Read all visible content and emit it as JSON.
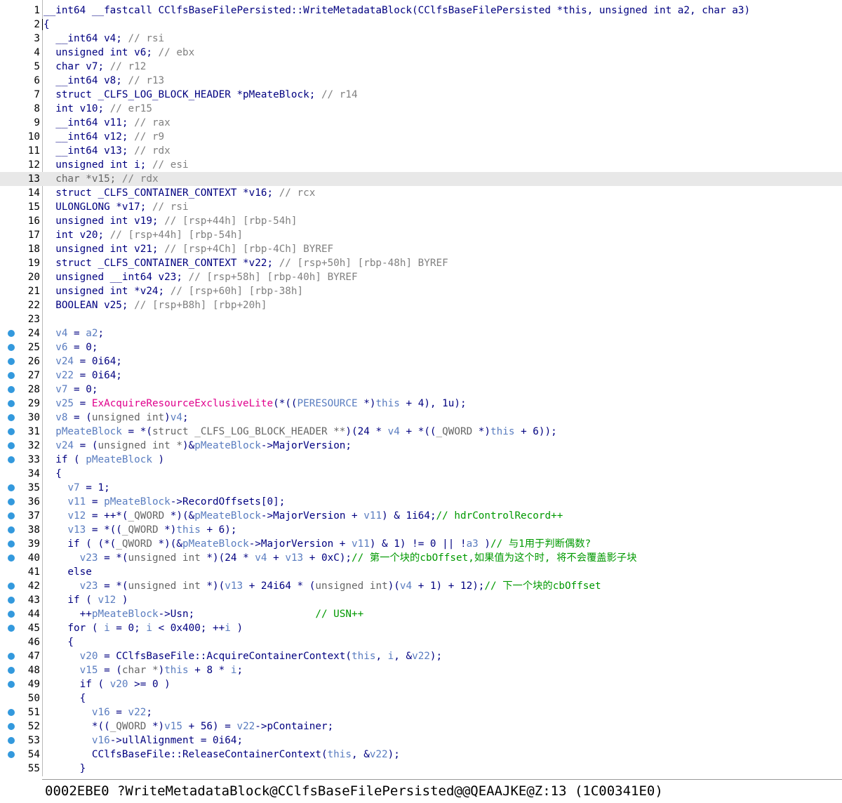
{
  "editor": {
    "highlighted_line": 13,
    "caret_line": 2,
    "lines": [
      {
        "n": "1",
        "bp": false,
        "t": [
          [
            "tp",
            "__int64 __fastcall CClfsBaseFilePersisted::WriteMetadataBlock(CClfsBaseFilePersisted *this, unsigned int a2, char a3)"
          ]
        ]
      },
      {
        "n": "2",
        "bp": false,
        "t": [
          [
            "pl",
            "{"
          ]
        ]
      },
      {
        "n": "3",
        "bp": false,
        "t": [
          [
            "tp",
            "  __int64 v4; "
          ],
          [
            "cmg",
            "// rsi"
          ]
        ]
      },
      {
        "n": "4",
        "bp": false,
        "t": [
          [
            "tp",
            "  unsigned int v6; "
          ],
          [
            "cmg",
            "// ebx"
          ]
        ]
      },
      {
        "n": "5",
        "bp": false,
        "t": [
          [
            "tp",
            "  char v7; "
          ],
          [
            "cmg",
            "// r12"
          ]
        ]
      },
      {
        "n": "6",
        "bp": false,
        "t": [
          [
            "tp",
            "  __int64 v8; "
          ],
          [
            "cmg",
            "// r13"
          ]
        ]
      },
      {
        "n": "7",
        "bp": false,
        "t": [
          [
            "tp",
            "  struct _CLFS_LOG_BLOCK_HEADER *pMeateBlock; "
          ],
          [
            "cmg",
            "// r14"
          ]
        ]
      },
      {
        "n": "8",
        "bp": false,
        "t": [
          [
            "tp",
            "  int v10; "
          ],
          [
            "cmg",
            "// er15"
          ]
        ]
      },
      {
        "n": "9",
        "bp": false,
        "t": [
          [
            "tp",
            "  __int64 v11; "
          ],
          [
            "cmg",
            "// rax"
          ]
        ]
      },
      {
        "n": "10",
        "bp": false,
        "t": [
          [
            "tp",
            "  __int64 v12; "
          ],
          [
            "cmg",
            "// r9"
          ]
        ]
      },
      {
        "n": "11",
        "bp": false,
        "t": [
          [
            "tp",
            "  __int64 v13; "
          ],
          [
            "cmg",
            "// rdx"
          ]
        ]
      },
      {
        "n": "12",
        "bp": false,
        "t": [
          [
            "tp",
            "  unsigned int i; "
          ],
          [
            "cmg",
            "// esi"
          ]
        ]
      },
      {
        "n": "13",
        "bp": false,
        "t": [
          [
            "dim",
            "  char *v15; "
          ],
          [
            "cmg",
            "// rdx"
          ]
        ]
      },
      {
        "n": "14",
        "bp": false,
        "t": [
          [
            "tp",
            "  struct _CLFS_CONTAINER_CONTEXT *v16; "
          ],
          [
            "cmg",
            "// rcx"
          ]
        ]
      },
      {
        "n": "15",
        "bp": false,
        "t": [
          [
            "tp",
            "  ULONGLONG *v17; "
          ],
          [
            "cmg",
            "// rsi"
          ]
        ]
      },
      {
        "n": "16",
        "bp": false,
        "t": [
          [
            "tp",
            "  unsigned int v19; "
          ],
          [
            "cmg",
            "// [rsp+44h] [rbp-54h]"
          ]
        ]
      },
      {
        "n": "17",
        "bp": false,
        "t": [
          [
            "tp",
            "  int v20; "
          ],
          [
            "cmg",
            "// [rsp+44h] [rbp-54h]"
          ]
        ]
      },
      {
        "n": "18",
        "bp": false,
        "t": [
          [
            "tp",
            "  unsigned int v21; "
          ],
          [
            "cmg",
            "// [rsp+4Ch] [rbp-4Ch] BYREF"
          ]
        ]
      },
      {
        "n": "19",
        "bp": false,
        "t": [
          [
            "tp",
            "  struct _CLFS_CONTAINER_CONTEXT *v22; "
          ],
          [
            "cmg",
            "// [rsp+50h] [rbp-48h] BYREF"
          ]
        ]
      },
      {
        "n": "20",
        "bp": false,
        "t": [
          [
            "tp",
            "  unsigned __int64 v23; "
          ],
          [
            "cmg",
            "// [rsp+58h] [rbp-40h] BYREF"
          ]
        ]
      },
      {
        "n": "21",
        "bp": false,
        "t": [
          [
            "tp",
            "  unsigned int *v24; "
          ],
          [
            "cmg",
            "// [rsp+60h] [rbp-38h]"
          ]
        ]
      },
      {
        "n": "22",
        "bp": false,
        "t": [
          [
            "tp",
            "  BOOLEAN v25; "
          ],
          [
            "cmg",
            "// [rsp+B8h] [rbp+20h]"
          ]
        ]
      },
      {
        "n": "23",
        "bp": false,
        "t": [
          [
            "pl",
            ""
          ]
        ]
      },
      {
        "n": "24",
        "bp": true,
        "t": [
          [
            "pl",
            "  "
          ],
          [
            "vr",
            "v4"
          ],
          [
            "pl",
            " = "
          ],
          [
            "vr",
            "a2"
          ],
          [
            "pl",
            ";"
          ]
        ]
      },
      {
        "n": "25",
        "bp": true,
        "t": [
          [
            "pl",
            "  "
          ],
          [
            "vr",
            "v6"
          ],
          [
            "pl",
            " = 0;"
          ]
        ]
      },
      {
        "n": "26",
        "bp": true,
        "t": [
          [
            "pl",
            "  "
          ],
          [
            "vr",
            "v24"
          ],
          [
            "pl",
            " = 0i64;"
          ]
        ]
      },
      {
        "n": "27",
        "bp": true,
        "t": [
          [
            "pl",
            "  "
          ],
          [
            "vr",
            "v22"
          ],
          [
            "pl",
            " = 0i64;"
          ]
        ]
      },
      {
        "n": "28",
        "bp": true,
        "t": [
          [
            "pl",
            "  "
          ],
          [
            "vr",
            "v7"
          ],
          [
            "pl",
            " = 0;"
          ]
        ]
      },
      {
        "n": "29",
        "bp": true,
        "t": [
          [
            "pl",
            "  "
          ],
          [
            "vr",
            "v25"
          ],
          [
            "pl",
            " = "
          ],
          [
            "fn",
            "ExAcquireResourceExclusiveLite"
          ],
          [
            "pl",
            "(*(("
          ],
          [
            "vr",
            "PERESOURCE"
          ],
          [
            "pl",
            " *)"
          ],
          [
            "vr",
            "this"
          ],
          [
            "pl",
            " + 4), 1u);"
          ]
        ]
      },
      {
        "n": "30",
        "bp": true,
        "t": [
          [
            "pl",
            "  "
          ],
          [
            "vr",
            "v8"
          ],
          [
            "pl",
            " = ("
          ],
          [
            "dim",
            "unsigned int"
          ],
          [
            "pl",
            ")"
          ],
          [
            "vr",
            "v4"
          ],
          [
            "pl",
            ";"
          ]
        ]
      },
      {
        "n": "31",
        "bp": true,
        "t": [
          [
            "pl",
            "  "
          ],
          [
            "vr",
            "pMeateBlock"
          ],
          [
            "pl",
            " = *("
          ],
          [
            "dim",
            "struct _CLFS_LOG_BLOCK_HEADER **"
          ],
          [
            "pl",
            ")(24 * "
          ],
          [
            "vr",
            "v4"
          ],
          [
            "pl",
            " + *(("
          ],
          [
            "dim",
            "_QWORD"
          ],
          [
            "pl",
            " *)"
          ],
          [
            "vr",
            "this"
          ],
          [
            "pl",
            " + 6));"
          ]
        ]
      },
      {
        "n": "32",
        "bp": true,
        "t": [
          [
            "pl",
            "  "
          ],
          [
            "vr",
            "v24"
          ],
          [
            "pl",
            " = ("
          ],
          [
            "dim",
            "unsigned int *"
          ],
          [
            "pl",
            ")&"
          ],
          [
            "vr",
            "pMeateBlock"
          ],
          [
            "pl",
            "->MajorVersion;"
          ]
        ]
      },
      {
        "n": "33",
        "bp": true,
        "t": [
          [
            "pl",
            "  if ( "
          ],
          [
            "vr",
            "pMeateBlock"
          ],
          [
            "pl",
            " )"
          ]
        ]
      },
      {
        "n": "34",
        "bp": false,
        "t": [
          [
            "pl",
            "  {"
          ]
        ]
      },
      {
        "n": "35",
        "bp": true,
        "t": [
          [
            "pl",
            "    "
          ],
          [
            "vr",
            "v7"
          ],
          [
            "pl",
            " = 1;"
          ]
        ]
      },
      {
        "n": "36",
        "bp": true,
        "t": [
          [
            "pl",
            "    "
          ],
          [
            "vr",
            "v11"
          ],
          [
            "pl",
            " = "
          ],
          [
            "vr",
            "pMeateBlock"
          ],
          [
            "pl",
            "->RecordOffsets[0];"
          ]
        ]
      },
      {
        "n": "37",
        "bp": true,
        "t": [
          [
            "pl",
            "    "
          ],
          [
            "vr",
            "v12"
          ],
          [
            "pl",
            " = ++*("
          ],
          [
            "dim",
            "_QWORD"
          ],
          [
            "pl",
            " *)(&"
          ],
          [
            "vr",
            "pMeateBlock"
          ],
          [
            "pl",
            "->MajorVersion + "
          ],
          [
            "vr",
            "v11"
          ],
          [
            "pl",
            ") & 1i64;"
          ],
          [
            "cm",
            "// hdrControlRecord++"
          ]
        ]
      },
      {
        "n": "38",
        "bp": true,
        "t": [
          [
            "pl",
            "    "
          ],
          [
            "vr",
            "v13"
          ],
          [
            "pl",
            " = *(("
          ],
          [
            "dim",
            "_QWORD"
          ],
          [
            "pl",
            " *)"
          ],
          [
            "vr",
            "this"
          ],
          [
            "pl",
            " + 6);"
          ]
        ]
      },
      {
        "n": "39",
        "bp": true,
        "t": [
          [
            "pl",
            "    if ( (*("
          ],
          [
            "dim",
            "_QWORD"
          ],
          [
            "pl",
            " *)(&"
          ],
          [
            "vr",
            "pMeateBlock"
          ],
          [
            "pl",
            "->MajorVersion + "
          ],
          [
            "vr",
            "v11"
          ],
          [
            "pl",
            ") & 1) != 0 || !"
          ],
          [
            "vr",
            "a3"
          ],
          [
            "pl",
            " )"
          ],
          [
            "cm",
            "// 与1用于判断偶数?"
          ]
        ]
      },
      {
        "n": "40",
        "bp": true,
        "t": [
          [
            "pl",
            "      "
          ],
          [
            "vr",
            "v23"
          ],
          [
            "pl",
            " = *("
          ],
          [
            "dim",
            "unsigned int"
          ],
          [
            "pl",
            " *)(24 * "
          ],
          [
            "vr",
            "v4"
          ],
          [
            "pl",
            " + "
          ],
          [
            "vr",
            "v13"
          ],
          [
            "pl",
            " + 0xC);"
          ],
          [
            "cm",
            "// 第一个块的cbOffset,如果值为这个时, 将不会覆盖影子块"
          ]
        ]
      },
      {
        "n": "41",
        "bp": false,
        "t": [
          [
            "pl",
            "    else"
          ]
        ]
      },
      {
        "n": "42",
        "bp": true,
        "t": [
          [
            "pl",
            "      "
          ],
          [
            "vr",
            "v23"
          ],
          [
            "pl",
            " = *("
          ],
          [
            "dim",
            "unsigned int"
          ],
          [
            "pl",
            " *)("
          ],
          [
            "vr",
            "v13"
          ],
          [
            "pl",
            " + 24i64 * ("
          ],
          [
            "dim",
            "unsigned int"
          ],
          [
            "pl",
            ")("
          ],
          [
            "vr",
            "v4"
          ],
          [
            "pl",
            " + 1) + 12);"
          ],
          [
            "cm",
            "// 下一个块的cbOffset"
          ]
        ]
      },
      {
        "n": "43",
        "bp": true,
        "t": [
          [
            "pl",
            "    if ( "
          ],
          [
            "vr",
            "v12"
          ],
          [
            "pl",
            " )"
          ]
        ]
      },
      {
        "n": "44",
        "bp": true,
        "t": [
          [
            "pl",
            "      ++"
          ],
          [
            "vr",
            "pMeateBlock"
          ],
          [
            "pl",
            "->Usn;                    "
          ],
          [
            "cm",
            "// USN++"
          ]
        ]
      },
      {
        "n": "45",
        "bp": true,
        "t": [
          [
            "pl",
            "    for ( "
          ],
          [
            "vr",
            "i"
          ],
          [
            "pl",
            " = 0; "
          ],
          [
            "vr",
            "i"
          ],
          [
            "pl",
            " < 0x400; ++"
          ],
          [
            "vr",
            "i"
          ],
          [
            "pl",
            " )"
          ]
        ]
      },
      {
        "n": "46",
        "bp": false,
        "t": [
          [
            "pl",
            "    {"
          ]
        ]
      },
      {
        "n": "47",
        "bp": true,
        "t": [
          [
            "pl",
            "      "
          ],
          [
            "vr",
            "v20"
          ],
          [
            "pl",
            " = CClfsBaseFile::AcquireContainerContext("
          ],
          [
            "vr",
            "this"
          ],
          [
            "pl",
            ", "
          ],
          [
            "vr",
            "i"
          ],
          [
            "pl",
            ", &"
          ],
          [
            "vr",
            "v22"
          ],
          [
            "pl",
            ");"
          ]
        ]
      },
      {
        "n": "48",
        "bp": true,
        "t": [
          [
            "pl",
            "      "
          ],
          [
            "vr",
            "v15"
          ],
          [
            "pl",
            " = ("
          ],
          [
            "dim",
            "char *"
          ],
          [
            "pl",
            ")"
          ],
          [
            "vr",
            "this"
          ],
          [
            "pl",
            " + 8 * "
          ],
          [
            "vr",
            "i"
          ],
          [
            "pl",
            ";"
          ]
        ]
      },
      {
        "n": "49",
        "bp": true,
        "t": [
          [
            "pl",
            "      if ( "
          ],
          [
            "vr",
            "v20"
          ],
          [
            "pl",
            " >= 0 )"
          ]
        ]
      },
      {
        "n": "50",
        "bp": false,
        "t": [
          [
            "pl",
            "      {"
          ]
        ]
      },
      {
        "n": "51",
        "bp": true,
        "t": [
          [
            "pl",
            "        "
          ],
          [
            "vr",
            "v16"
          ],
          [
            "pl",
            " = "
          ],
          [
            "vr",
            "v22"
          ],
          [
            "pl",
            ";"
          ]
        ]
      },
      {
        "n": "52",
        "bp": true,
        "t": [
          [
            "pl",
            "        *(("
          ],
          [
            "dim",
            "_QWORD"
          ],
          [
            "pl",
            " *)"
          ],
          [
            "vr",
            "v15"
          ],
          [
            "pl",
            " + 56) = "
          ],
          [
            "vr",
            "v22"
          ],
          [
            "pl",
            "->pContainer;"
          ]
        ]
      },
      {
        "n": "53",
        "bp": true,
        "t": [
          [
            "pl",
            "        "
          ],
          [
            "vr",
            "v16"
          ],
          [
            "pl",
            "->ullAlignment = 0i64;"
          ]
        ]
      },
      {
        "n": "54",
        "bp": true,
        "t": [
          [
            "pl",
            "        CClfsBaseFile::ReleaseContainerContext("
          ],
          [
            "vr",
            "this"
          ],
          [
            "pl",
            ", &"
          ],
          [
            "vr",
            "v22"
          ],
          [
            "pl",
            ");"
          ]
        ]
      },
      {
        "n": "55",
        "bp": false,
        "t": [
          [
            "pl",
            "      }"
          ]
        ]
      }
    ]
  },
  "statusbar": {
    "text": "0002EBE0 ?WriteMetadataBlock@CClfsBaseFilePersisted@@QEAAJKE@Z:13 (1C00341E0)"
  },
  "colors": {
    "breakpoint": "#3399dd",
    "highlight": "#e8e8e8",
    "comment": "#009900",
    "function": "#e0008c",
    "variable": "#5a7dc0"
  }
}
